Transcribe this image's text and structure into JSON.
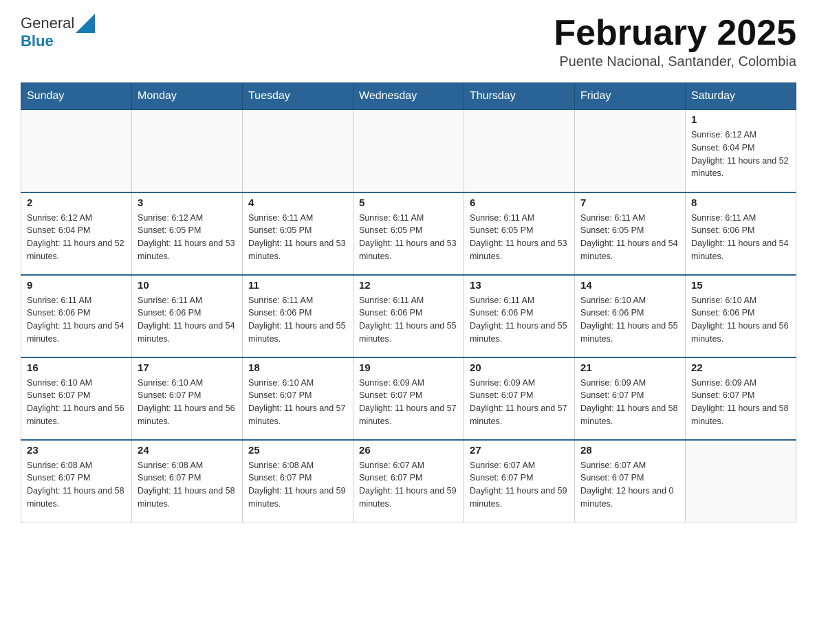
{
  "header": {
    "logo_general": "General",
    "logo_blue": "Blue",
    "month_title": "February 2025",
    "subtitle": "Puente Nacional, Santander, Colombia"
  },
  "days_of_week": [
    "Sunday",
    "Monday",
    "Tuesday",
    "Wednesday",
    "Thursday",
    "Friday",
    "Saturday"
  ],
  "weeks": [
    [
      {
        "day": "",
        "sunrise": "",
        "sunset": "",
        "daylight": ""
      },
      {
        "day": "",
        "sunrise": "",
        "sunset": "",
        "daylight": ""
      },
      {
        "day": "",
        "sunrise": "",
        "sunset": "",
        "daylight": ""
      },
      {
        "day": "",
        "sunrise": "",
        "sunset": "",
        "daylight": ""
      },
      {
        "day": "",
        "sunrise": "",
        "sunset": "",
        "daylight": ""
      },
      {
        "day": "",
        "sunrise": "",
        "sunset": "",
        "daylight": ""
      },
      {
        "day": "1",
        "sunrise": "Sunrise: 6:12 AM",
        "sunset": "Sunset: 6:04 PM",
        "daylight": "Daylight: 11 hours and 52 minutes."
      }
    ],
    [
      {
        "day": "2",
        "sunrise": "Sunrise: 6:12 AM",
        "sunset": "Sunset: 6:04 PM",
        "daylight": "Daylight: 11 hours and 52 minutes."
      },
      {
        "day": "3",
        "sunrise": "Sunrise: 6:12 AM",
        "sunset": "Sunset: 6:05 PM",
        "daylight": "Daylight: 11 hours and 53 minutes."
      },
      {
        "day": "4",
        "sunrise": "Sunrise: 6:11 AM",
        "sunset": "Sunset: 6:05 PM",
        "daylight": "Daylight: 11 hours and 53 minutes."
      },
      {
        "day": "5",
        "sunrise": "Sunrise: 6:11 AM",
        "sunset": "Sunset: 6:05 PM",
        "daylight": "Daylight: 11 hours and 53 minutes."
      },
      {
        "day": "6",
        "sunrise": "Sunrise: 6:11 AM",
        "sunset": "Sunset: 6:05 PM",
        "daylight": "Daylight: 11 hours and 53 minutes."
      },
      {
        "day": "7",
        "sunrise": "Sunrise: 6:11 AM",
        "sunset": "Sunset: 6:05 PM",
        "daylight": "Daylight: 11 hours and 54 minutes."
      },
      {
        "day": "8",
        "sunrise": "Sunrise: 6:11 AM",
        "sunset": "Sunset: 6:06 PM",
        "daylight": "Daylight: 11 hours and 54 minutes."
      }
    ],
    [
      {
        "day": "9",
        "sunrise": "Sunrise: 6:11 AM",
        "sunset": "Sunset: 6:06 PM",
        "daylight": "Daylight: 11 hours and 54 minutes."
      },
      {
        "day": "10",
        "sunrise": "Sunrise: 6:11 AM",
        "sunset": "Sunset: 6:06 PM",
        "daylight": "Daylight: 11 hours and 54 minutes."
      },
      {
        "day": "11",
        "sunrise": "Sunrise: 6:11 AM",
        "sunset": "Sunset: 6:06 PM",
        "daylight": "Daylight: 11 hours and 55 minutes."
      },
      {
        "day": "12",
        "sunrise": "Sunrise: 6:11 AM",
        "sunset": "Sunset: 6:06 PM",
        "daylight": "Daylight: 11 hours and 55 minutes."
      },
      {
        "day": "13",
        "sunrise": "Sunrise: 6:11 AM",
        "sunset": "Sunset: 6:06 PM",
        "daylight": "Daylight: 11 hours and 55 minutes."
      },
      {
        "day": "14",
        "sunrise": "Sunrise: 6:10 AM",
        "sunset": "Sunset: 6:06 PM",
        "daylight": "Daylight: 11 hours and 55 minutes."
      },
      {
        "day": "15",
        "sunrise": "Sunrise: 6:10 AM",
        "sunset": "Sunset: 6:06 PM",
        "daylight": "Daylight: 11 hours and 56 minutes."
      }
    ],
    [
      {
        "day": "16",
        "sunrise": "Sunrise: 6:10 AM",
        "sunset": "Sunset: 6:07 PM",
        "daylight": "Daylight: 11 hours and 56 minutes."
      },
      {
        "day": "17",
        "sunrise": "Sunrise: 6:10 AM",
        "sunset": "Sunset: 6:07 PM",
        "daylight": "Daylight: 11 hours and 56 minutes."
      },
      {
        "day": "18",
        "sunrise": "Sunrise: 6:10 AM",
        "sunset": "Sunset: 6:07 PM",
        "daylight": "Daylight: 11 hours and 57 minutes."
      },
      {
        "day": "19",
        "sunrise": "Sunrise: 6:09 AM",
        "sunset": "Sunset: 6:07 PM",
        "daylight": "Daylight: 11 hours and 57 minutes."
      },
      {
        "day": "20",
        "sunrise": "Sunrise: 6:09 AM",
        "sunset": "Sunset: 6:07 PM",
        "daylight": "Daylight: 11 hours and 57 minutes."
      },
      {
        "day": "21",
        "sunrise": "Sunrise: 6:09 AM",
        "sunset": "Sunset: 6:07 PM",
        "daylight": "Daylight: 11 hours and 58 minutes."
      },
      {
        "day": "22",
        "sunrise": "Sunrise: 6:09 AM",
        "sunset": "Sunset: 6:07 PM",
        "daylight": "Daylight: 11 hours and 58 minutes."
      }
    ],
    [
      {
        "day": "23",
        "sunrise": "Sunrise: 6:08 AM",
        "sunset": "Sunset: 6:07 PM",
        "daylight": "Daylight: 11 hours and 58 minutes."
      },
      {
        "day": "24",
        "sunrise": "Sunrise: 6:08 AM",
        "sunset": "Sunset: 6:07 PM",
        "daylight": "Daylight: 11 hours and 58 minutes."
      },
      {
        "day": "25",
        "sunrise": "Sunrise: 6:08 AM",
        "sunset": "Sunset: 6:07 PM",
        "daylight": "Daylight: 11 hours and 59 minutes."
      },
      {
        "day": "26",
        "sunrise": "Sunrise: 6:07 AM",
        "sunset": "Sunset: 6:07 PM",
        "daylight": "Daylight: 11 hours and 59 minutes."
      },
      {
        "day": "27",
        "sunrise": "Sunrise: 6:07 AM",
        "sunset": "Sunset: 6:07 PM",
        "daylight": "Daylight: 11 hours and 59 minutes."
      },
      {
        "day": "28",
        "sunrise": "Sunrise: 6:07 AM",
        "sunset": "Sunset: 6:07 PM",
        "daylight": "Daylight: 12 hours and 0 minutes."
      },
      {
        "day": "",
        "sunrise": "",
        "sunset": "",
        "daylight": ""
      }
    ]
  ]
}
